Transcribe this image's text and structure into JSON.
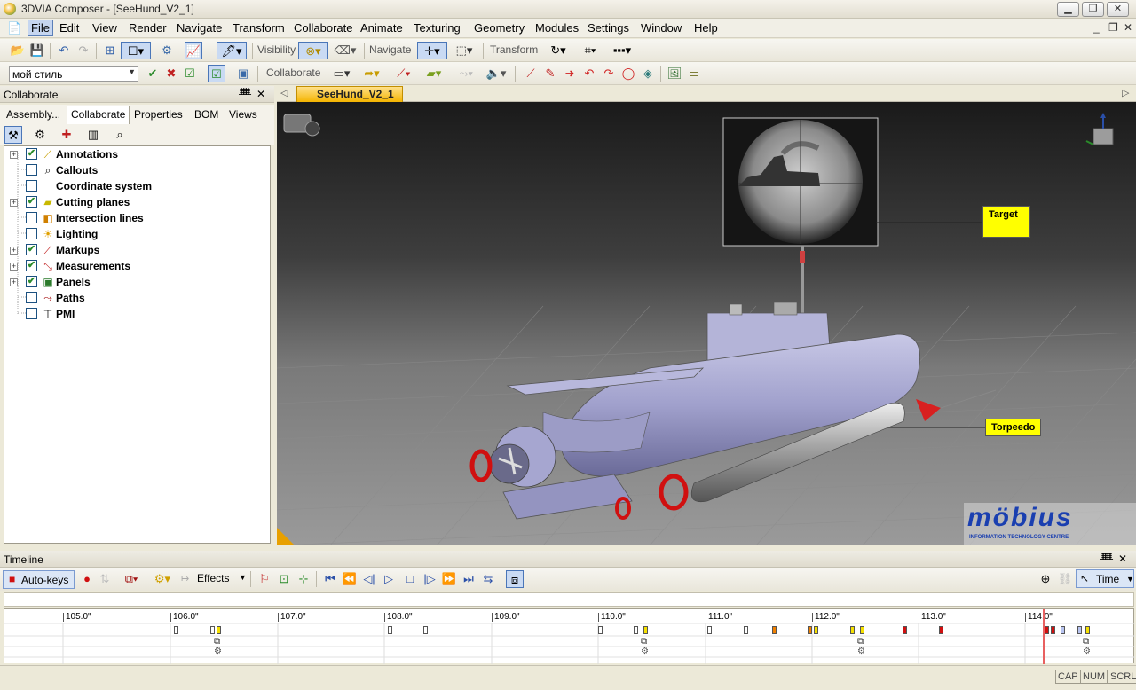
{
  "window": {
    "title": "3DVIA Composer - [SeeHund_V2_1]"
  },
  "menu": [
    "File",
    "Edit",
    "View",
    "Render",
    "Navigate",
    "Transform",
    "Collaborate",
    "Animate",
    "Texturing",
    "Geometry",
    "Modules",
    "Settings",
    "Window",
    "Help"
  ],
  "toolbar1": {
    "visibility_label": "Visibility",
    "navigate_label": "Navigate",
    "transform_label": "Transform"
  },
  "toolbar2": {
    "style_value": "мой стиль",
    "collaborate_label": "Collaborate"
  },
  "panel": {
    "title": "Collaborate",
    "tabs": [
      "Assembly...",
      "Collaborate",
      "Properties",
      "BOM",
      "Views"
    ],
    "tree": [
      {
        "label": "Annotations",
        "checked": true,
        "expandable": true
      },
      {
        "label": "Callouts",
        "checked": false,
        "expandable": false
      },
      {
        "label": "Coordinate system",
        "checked": false,
        "expandable": false
      },
      {
        "label": "Cutting planes",
        "checked": true,
        "expandable": true
      },
      {
        "label": "Intersection lines",
        "checked": false,
        "expandable": false
      },
      {
        "label": "Lighting",
        "checked": false,
        "expandable": false
      },
      {
        "label": "Markups",
        "checked": true,
        "expandable": true
      },
      {
        "label": "Measurements",
        "checked": true,
        "expandable": true
      },
      {
        "label": "Panels",
        "checked": true,
        "expandable": true
      },
      {
        "label": "Paths",
        "checked": false,
        "expandable": false
      },
      {
        "label": "PMI",
        "checked": false,
        "expandable": false
      }
    ]
  },
  "document": {
    "tab_label": "SeeHund_V2_1"
  },
  "viewport": {
    "callout_target": "Target",
    "callout_torpedo": "Torpeedo",
    "logo_text": "möbius",
    "logo_sub": "INFORMATION TECHNOLOGY CENTRE"
  },
  "timeline": {
    "title": "Timeline",
    "autokeys_label": "Auto-keys",
    "effects_label": "Effects",
    "time_label": "Time",
    "ticks": [
      "105.0\"",
      "106.0\"",
      "107.0\"",
      "108.0\"",
      "109.0\"",
      "110.0\"",
      "111.0\"",
      "112.0\"",
      "113.0\"",
      "114.0\""
    ]
  },
  "status": {
    "cap": "CAP",
    "num": "NUM",
    "scrl": "SCRL"
  }
}
